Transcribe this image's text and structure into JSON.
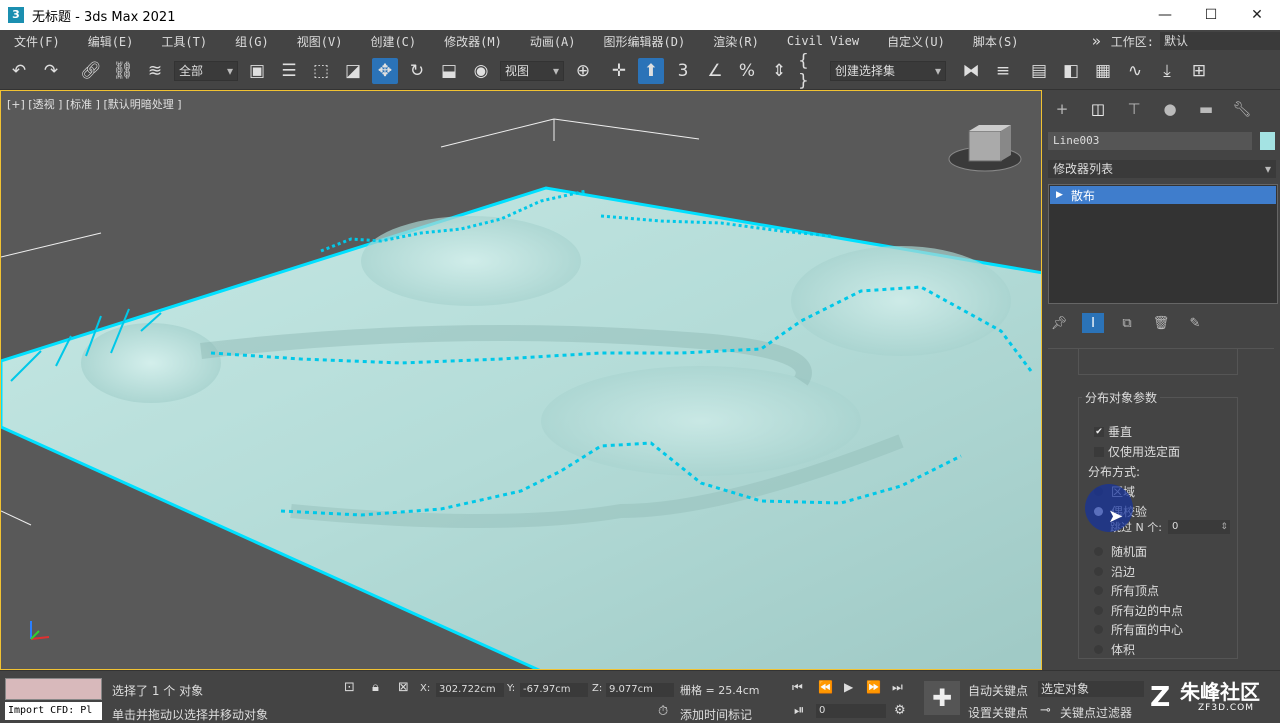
{
  "window": {
    "title": "无标题 - 3ds Max 2021",
    "minimize_icon": "minimize-icon",
    "maximize_icon": "maximize-icon",
    "close_icon": "close-icon"
  },
  "menu": {
    "items": [
      "文件(F)",
      "编辑(E)",
      "工具(T)",
      "组(G)",
      "视图(V)",
      "创建(C)",
      "修改器(M)",
      "动画(A)",
      "图形编辑器(D)",
      "渲染(R)",
      "Civil View",
      "自定义(U)",
      "脚本(S)"
    ],
    "more": "»",
    "workspace_label": "工作区:",
    "workspace_value": "默认"
  },
  "toolbar": {
    "selection_filter": "全部",
    "ref_coord": "视图",
    "named_selection": "创建选择集"
  },
  "viewport": {
    "label": "[+] [透视 ] [标准 ] [默认明暗处理 ]",
    "colors": {
      "terrain": "#b8e0dc",
      "selection": "#00e0ff",
      "background": "#5a5a5a"
    }
  },
  "command_panel": {
    "object_name": "Line003",
    "object_color": "#a4e3e3",
    "modifier_list_label": "修改器列表",
    "stack_item": "散布",
    "rollout": {
      "group_title": "分布对象参数",
      "perpendicular": "垂直",
      "use_selected_faces": "仅使用选定面",
      "distribution_label": "分布方式:",
      "area": "区域",
      "even": "偶校验",
      "skip_n": "跳过 N 个:",
      "skip_n_value": "0",
      "random_faces": "随机面",
      "along_edges": "沿边",
      "all_vertices": "所有顶点",
      "all_edge_midpoints": "所有边的中点",
      "all_face_centers": "所有面的中心",
      "volume": "体积"
    }
  },
  "status": {
    "import_text": "Import CFD: Pl",
    "selected": "选择了 1 个 对象",
    "prompt": "单击并拖动以选择并移动对象",
    "x_label": "X:",
    "x_value": "302.722cm",
    "y_label": "Y:",
    "y_value": "-67.97cm",
    "z_label": "Z:",
    "z_value": "9.077cm",
    "grid": "栅格 = 25.4cm",
    "add_time_tag": "添加时间标记",
    "auto_key": "自动关键点",
    "set_key": "设置关键点",
    "selected_object": "选定对象",
    "key_filters": "关键点过滤器",
    "frame_value": "0"
  },
  "watermark": {
    "brand": "朱峰社区",
    "url": "ZF3D.COM"
  }
}
